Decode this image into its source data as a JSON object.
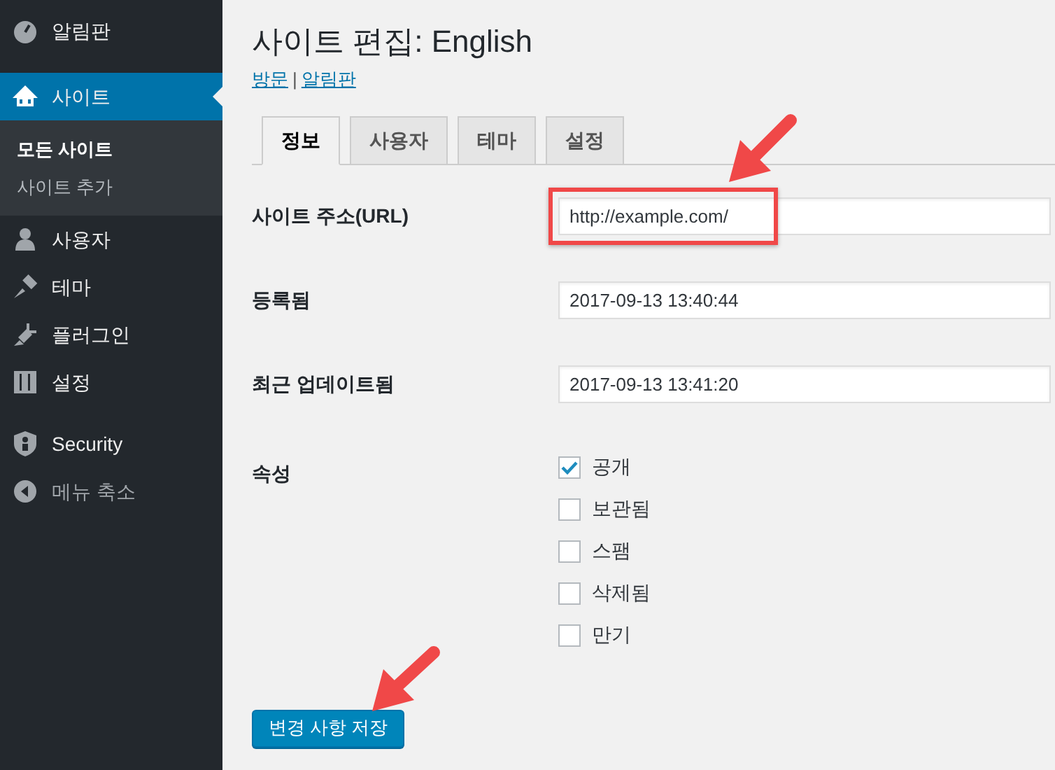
{
  "sidebar": {
    "items": [
      {
        "label": "알림판",
        "selected": false,
        "kind": "menu"
      },
      {
        "label": "사이트",
        "selected": true,
        "kind": "menu",
        "children": [
          {
            "label": "모든 사이트",
            "selected": true
          },
          {
            "label": "사이트 추가",
            "selected": false
          }
        ]
      },
      {
        "label": "사용자",
        "selected": false,
        "kind": "menu"
      },
      {
        "label": "테마",
        "selected": false,
        "kind": "menu"
      },
      {
        "label": "플러그인",
        "selected": false,
        "kind": "menu"
      },
      {
        "label": "설정",
        "selected": false,
        "kind": "menu"
      },
      {
        "label": "Security",
        "selected": false,
        "kind": "menu"
      },
      {
        "label": "메뉴 축소",
        "selected": false,
        "kind": "collapse"
      }
    ]
  },
  "page": {
    "title": "사이트 편집: English",
    "links": [
      "방문",
      "알림판"
    ],
    "link_separator": "|"
  },
  "tabs": [
    {
      "label": "정보",
      "selected": true
    },
    {
      "label": "사용자",
      "selected": false
    },
    {
      "label": "테마",
      "selected": false
    },
    {
      "label": "설정",
      "selected": false
    }
  ],
  "fields": [
    {
      "label": "사이트 주소(URL)",
      "value": "http://example.com/",
      "highlighted": true
    },
    {
      "label": "등록됨",
      "value": "2017-09-13 13:40:44",
      "highlighted": false
    },
    {
      "label": "최근 업데이트됨",
      "value": "2017-09-13 13:41:20",
      "highlighted": false
    }
  ],
  "attributes": {
    "label": "속성",
    "options": [
      {
        "label": "공개",
        "checked": true
      },
      {
        "label": "보관됨",
        "checked": false
      },
      {
        "label": "스팸",
        "checked": false
      },
      {
        "label": "삭제됨",
        "checked": false
      },
      {
        "label": "만기",
        "checked": false
      }
    ]
  },
  "save_button": "변경 사항 저장"
}
